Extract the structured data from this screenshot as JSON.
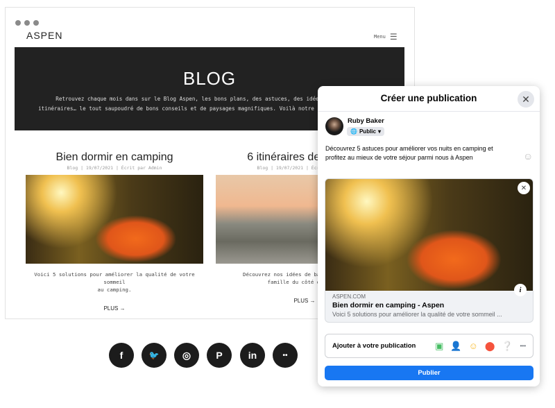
{
  "site": {
    "logo": "ASPEN",
    "menu_label": "Menu",
    "banner_title": "BLOG",
    "banner_text": [
      "Retrouvez chaque mois dans sur le Blog Aspen, les bons plans, des astuces, des idées sorties, des",
      "itinéraires… le tout saupoudré de bons conseils et de paysages magnifiques. Voilà notre recette du bonheur !"
    ],
    "posts": [
      {
        "title": "Bien dormir en camping",
        "meta": "Blog | 19/07/2021 | Écrit par Admin",
        "desc": [
          "Voici 5 solutions pour améliorer la qualité de votre sommeil",
          "au camping."
        ],
        "more": "PLUS →"
      },
      {
        "title": "6 itinéraires de balades",
        "meta": "Blog | 19/07/2021 | Écrit par Admin",
        "desc": [
          "Découvrez nos idées de balades nature en",
          "famille du côté d'Aspen."
        ],
        "more": "PLUS →"
      }
    ],
    "social": [
      {
        "icon": "facebook-icon",
        "glyph": "f"
      },
      {
        "icon": "twitter-icon",
        "glyph": "🐦"
      },
      {
        "icon": "instagram-icon",
        "glyph": "◎"
      },
      {
        "icon": "pinterest-icon",
        "glyph": "P"
      },
      {
        "icon": "linkedin-icon",
        "glyph": "in"
      },
      {
        "icon": "flickr-icon",
        "glyph": "••"
      }
    ]
  },
  "modal": {
    "title": "Créer une publication",
    "user": "Ruby Baker",
    "audience": "Public",
    "post_text": [
      "Découvrez 5 astuces pour améliorer vos nuits en camping et",
      "profitez au mieux de votre séjour parmi nous à Aspen"
    ],
    "link": {
      "domain": "ASPEN.COM",
      "title": "Bien dormir en camping - Aspen",
      "desc": "Voici 5 solutions pour améliorer la qualité de votre sommeil ..."
    },
    "add_label": "Ajouter à votre publication",
    "more_glyph": "•••",
    "publish": "Publier",
    "colors": {
      "publish": "#1877f2",
      "photo": "#45bd62",
      "tag": "#1877f2",
      "feeling": "#f7b928",
      "location": "#f5533d",
      "qa": "#bcc0c4"
    }
  }
}
